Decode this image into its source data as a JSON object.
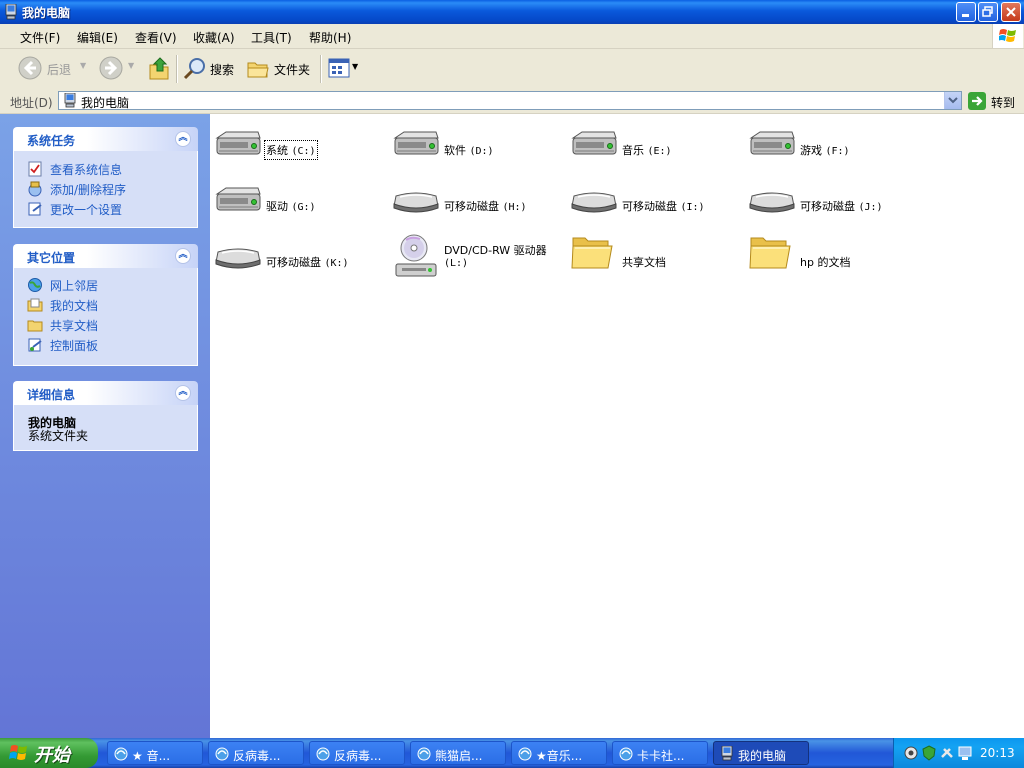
{
  "window": {
    "title": "我的电脑"
  },
  "menu": [
    "文件(F)",
    "编辑(E)",
    "查看(V)",
    "收藏(A)",
    "工具(T)",
    "帮助(H)"
  ],
  "toolbar": {
    "back": "后退",
    "search": "搜索",
    "folders": "文件夹"
  },
  "address": {
    "label": "地址(D)",
    "value": "我的电脑",
    "go": "转到"
  },
  "left": {
    "system_tasks": {
      "title": "系统任务",
      "links": [
        "查看系统信息",
        "添加/删除程序",
        "更改一个设置"
      ]
    },
    "other_places": {
      "title": "其它位置",
      "links": [
        "网上邻居",
        "我的文档",
        "共享文档",
        "控制面板"
      ]
    },
    "details": {
      "title": "详细信息",
      "name": "我的电脑",
      "desc": "系统文件夹"
    }
  },
  "items": [
    {
      "name": "系统",
      "letter": "(C:)",
      "type": "hdd",
      "selected": true
    },
    {
      "name": "软件",
      "letter": "(D:)",
      "type": "hdd"
    },
    {
      "name": "音乐",
      "letter": "(E:)",
      "type": "hdd"
    },
    {
      "name": "游戏",
      "letter": "(F:)",
      "type": "hdd"
    },
    {
      "name": "驱动",
      "letter": "(G:)",
      "type": "hdd"
    },
    {
      "name": "可移动磁盘",
      "letter": "(H:)",
      "type": "removable"
    },
    {
      "name": "可移动磁盘",
      "letter": "(I:)",
      "type": "removable"
    },
    {
      "name": "可移动磁盘",
      "letter": "(J:)",
      "type": "removable"
    },
    {
      "name": "可移动磁盘",
      "letter": "(K:)",
      "type": "removable"
    },
    {
      "name": "DVD/CD-RW 驱动器",
      "letter": "(L:)",
      "type": "cdrom"
    },
    {
      "name": "共享文档",
      "letter": "",
      "type": "folder"
    },
    {
      "name": "hp 的文档",
      "letter": "",
      "type": "folder"
    }
  ],
  "taskbar": {
    "start": "开始",
    "tasks": [
      "★ 音...",
      "反病毒...",
      "反病毒...",
      "熊猫启...",
      "★音乐...",
      "卡卡社...",
      "我的电脑"
    ],
    "clock": "20:13"
  }
}
